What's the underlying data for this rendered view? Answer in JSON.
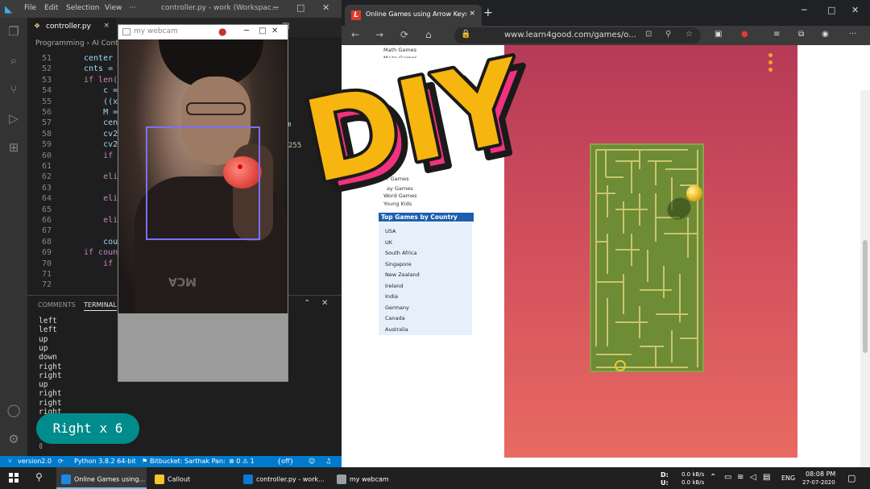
{
  "vscode": {
    "menu": [
      "File",
      "Edit",
      "Selection",
      "View",
      "···"
    ],
    "title": "controller.py - work (Workspac...",
    "tab_label": "controller.py",
    "tab_close": "×",
    "breadcrumb": "Programming › AI Contr",
    "code_lines": [
      {
        "num": "51",
        "text": "center ="
      },
      {
        "num": "52",
        "text": "cnts = i"
      },
      {
        "num": "53",
        "text": "if len(c"
      },
      {
        "num": "54",
        "text": "    c ="
      },
      {
        "num": "55",
        "text": "    ((x,"
      },
      {
        "num": "56",
        "text": "    M ="
      },
      {
        "num": "57",
        "text": "    cent"
      },
      {
        "num": "58",
        "text": "    cv2."
      },
      {
        "num": "59",
        "text": "    cv2."
      },
      {
        "num": "60",
        "text": "    if c"
      },
      {
        "num": "61",
        "text": ""
      },
      {
        "num": "62",
        "text": "    elif"
      },
      {
        "num": "63",
        "text": ""
      },
      {
        "num": "64",
        "text": "    elif"
      },
      {
        "num": "65",
        "text": ""
      },
      {
        "num": "66",
        "text": "    elif"
      },
      {
        "num": "67",
        "text": ""
      },
      {
        "num": "68",
        "text": "    coun"
      },
      {
        "num": "69",
        "text": "if count"
      },
      {
        "num": "70",
        "text": "    if d"
      },
      {
        "num": "71",
        "text": ""
      },
      {
        "num": "72",
        "text": ""
      }
    ],
    "code_fragments": {
      "m": "m",
      "n255": "255"
    },
    "panel_tabs": {
      "comments": "COMMENTS",
      "terminal": "TERMINAL"
    },
    "terminal_lines": [
      "left",
      "left",
      "up",
      "up",
      "down",
      "right",
      "right",
      "up",
      "right",
      "right",
      "right"
    ],
    "terminal_cursor": "▯",
    "status": {
      "branch": "version2.0",
      "python": "Python 3.8.2 64-bit",
      "bitbucket": "Bitbucket: Sarthak Pan:",
      "problems": "⊗ 0 ⚠ 1",
      "off": "{off}"
    }
  },
  "webcam": {
    "title": "my webcam",
    "shirt_text": "MCA"
  },
  "overlay": {
    "diy": "DIY",
    "callout": "Right x 6"
  },
  "browser": {
    "tab_title": "Online Games using Arrow Keys",
    "tab_close": "×",
    "favicon_letter": "L",
    "url": "www.learn4good.com/games/o...",
    "sidebar_links": [
      "Math Games",
      "Maze Games",
      "Strategy Games",
      "Word Games",
      "Young Kids"
    ],
    "sidebar_partial": [
      "r Games",
      "ay Games"
    ],
    "country_heading": "Top Games by Country",
    "countries": [
      "USA",
      "UK",
      "South Africa",
      "Singapore",
      "New Zealand",
      "Ireland",
      "India",
      "Germany",
      "Canada",
      "Australia"
    ]
  },
  "taskbar": {
    "items": [
      {
        "label": "Online Games using...",
        "color": "#1e88e5"
      },
      {
        "label": "Callout",
        "color": "#f4c430"
      },
      {
        "label": "controller.py - work...",
        "color": "#0a7ad4"
      },
      {
        "label": "my webcam",
        "color": "#9aa0a6"
      }
    ],
    "net_down_label": "D:",
    "net_up_label": "U:",
    "net_down": "0.0 kB/s",
    "net_up": "0.0 kB/s",
    "language": "ENG",
    "time": "08:08 PM",
    "date": "27-07-2020"
  },
  "colors": {
    "vscode_accent": "#007acc",
    "game_maze": "#6e8b35",
    "callout": "#008c8c",
    "sidebar_heading": "#1b5fae"
  }
}
